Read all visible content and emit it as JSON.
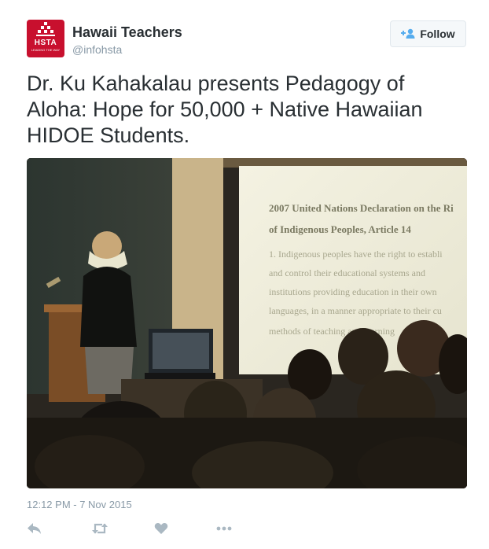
{
  "account": {
    "name": "Hawaii Teachers",
    "handle": "@infohsta",
    "avatar": {
      "logo_text": "HSTA",
      "tagline": "LEADING THE WAY"
    }
  },
  "follow_button": {
    "label": "Follow",
    "icon": "follow-person-plus-icon"
  },
  "tweet": {
    "text": "Dr. Ku Kahakalau presents Pedagogy of Aloha: Hope for 50,000 + Native Hawaiian HIDOE Students.",
    "timestamp": "12:12 PM - 7 Nov 2015"
  },
  "photo": {
    "slide_lines": [
      "2007 United Nations Declaration on the Ri",
      "of Indigenous Peoples, Article 14",
      "1. Indigenous peoples have the right to establi",
      "and control their educational systems and",
      "institutions providing education in their own",
      "languages, in a manner appropriate to their cu",
      "methods of teaching and learning"
    ]
  },
  "actions": [
    {
      "name": "reply",
      "icon": "reply-icon"
    },
    {
      "name": "retweet",
      "icon": "retweet-icon"
    },
    {
      "name": "like",
      "icon": "heart-icon"
    },
    {
      "name": "more",
      "icon": "more-dots-icon"
    }
  ],
  "colors": {
    "brand_red": "#c8102e",
    "text": "#292f33",
    "muted": "#8899a6",
    "follow_blue": "#55acee"
  }
}
